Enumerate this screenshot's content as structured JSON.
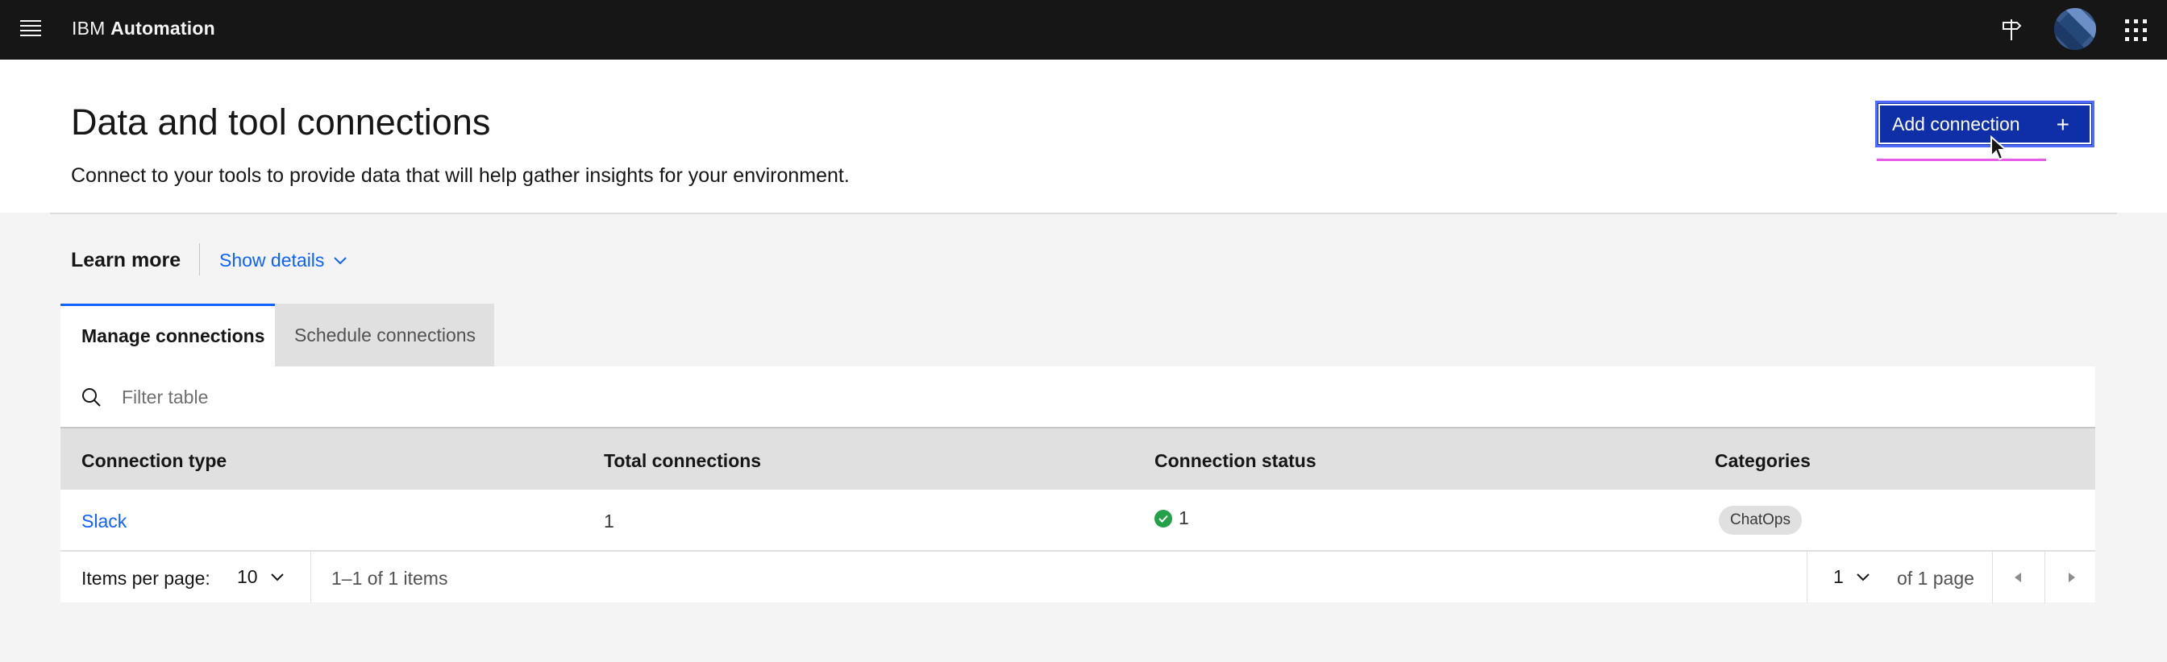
{
  "header": {
    "brand_prefix": "IBM",
    "brand_name": "Automation",
    "icons": [
      "menu-icon",
      "pin-icon",
      "avatar",
      "app-switcher-icon"
    ]
  },
  "page": {
    "title": "Data and tool connections",
    "subtitle": "Connect to your tools to provide data that will help gather insights for your environment.",
    "add_button_label": "Add connection",
    "add_button_icon": "+"
  },
  "learn_more": {
    "label": "Learn more",
    "show_details": "Show details"
  },
  "tabs": [
    {
      "label": "Manage connections",
      "selected": true
    },
    {
      "label": "Schedule connections",
      "selected": false
    }
  ],
  "table": {
    "search_placeholder": "Filter table",
    "columns": [
      "Connection type",
      "Total connections",
      "Connection status",
      "Categories"
    ],
    "rows": [
      {
        "type": "Slack",
        "total": "1",
        "status_count": "1",
        "status": "success",
        "category": "ChatOps"
      }
    ]
  },
  "pagination": {
    "items_per_page_label": "Items per page:",
    "items_per_page_value": "10",
    "range_text": "1–1 of 1 items",
    "page_value": "1",
    "page_total_text": "of 1 page"
  },
  "colors": {
    "topbar": "#161616",
    "primary_button": "#0f2fa8",
    "link": "#0f62fe",
    "success": "#24a148"
  }
}
